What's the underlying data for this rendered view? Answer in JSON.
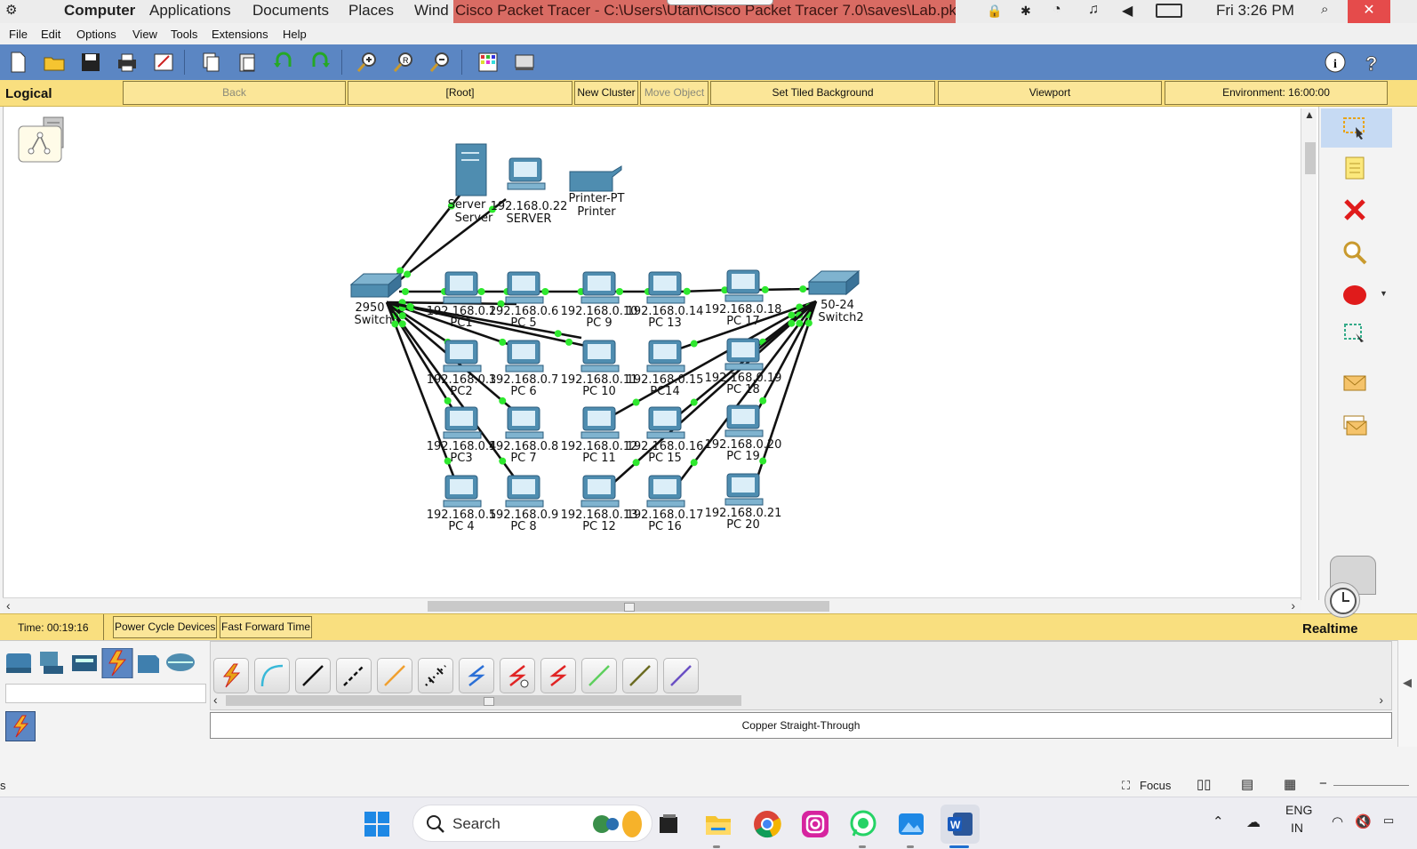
{
  "os_topbar": {
    "menu_items": [
      "Computer",
      "Applications",
      "Documents",
      "Places",
      "Wind"
    ],
    "window_title": "Cisco Packet Tracer - C:\\Users\\Utari\\Cisco Packet Tracer 7.0\\saves\\Lab.pkt",
    "clock": "Fri 3:26 PM",
    "close_glyph": "✕"
  },
  "menubar": {
    "items": [
      "File",
      "Edit",
      "Options",
      "View",
      "Tools",
      "Extensions",
      "Help"
    ]
  },
  "toolbar": {
    "icons": [
      "new-file-icon",
      "open-folder-icon",
      "save-icon",
      "print-icon",
      "activity-wizard-icon",
      "copy-icon",
      "paste-icon",
      "undo-icon",
      "redo-icon",
      "zoom-in-icon",
      "zoom-reset-icon",
      "zoom-out-icon",
      "palette-icon",
      "custom-device-icon",
      "info-icon",
      "help-icon"
    ]
  },
  "logical_bar": {
    "label": "Logical",
    "back": "Back",
    "root": "[Root]",
    "new_cluster": "New Cluster",
    "move_object": "Move Object",
    "set_tiled_background": "Set Tiled Background",
    "viewport": "Viewport",
    "environment": "Environment: 16:00:00"
  },
  "topology": {
    "colors": {
      "link": "#111111",
      "link_light": "#2ee82e",
      "device": "#4f8db0"
    },
    "servers": [
      {
        "label1": "Server",
        "label2": "Server"
      },
      {
        "label1": "192.168.0.22",
        "label2": "SERVER"
      }
    ],
    "printer": {
      "label1": "Printer-PT",
      "label2": "Printer"
    },
    "switches": [
      {
        "label1": "2950",
        "label2": "Switch"
      },
      {
        "label1": "50-24",
        "label2": "Switch2"
      }
    ],
    "pcs": [
      {
        "ip": "192.168.0.2",
        "name": "PC1"
      },
      {
        "ip": "192.168.0.6",
        "name": "PC 5"
      },
      {
        "ip": "192.168.0.10",
        "name": "PC 9"
      },
      {
        "ip": "192.168.0.14",
        "name": "PC 13"
      },
      {
        "ip": "192.168.0.18",
        "name": "PC 17"
      },
      {
        "ip": "192.168.0.3",
        "name": "PC2"
      },
      {
        "ip": "192.168.0.7",
        "name": "PC 6"
      },
      {
        "ip": "192.168.0.11",
        "name": "PC 10"
      },
      {
        "ip": "192.168.0.15",
        "name": "PC14"
      },
      {
        "ip": "192.168.0.19",
        "name": "PC 18"
      },
      {
        "ip": "192.168.0.4",
        "name": "PC3"
      },
      {
        "ip": "192.168.0.8",
        "name": "PC 7"
      },
      {
        "ip": "192.168.0.12",
        "name": "PC 11"
      },
      {
        "ip": "192.168.0.16",
        "name": "PC 15"
      },
      {
        "ip": "192.168.0.20",
        "name": "PC 19"
      },
      {
        "ip": "192.168.0.5",
        "name": "PC 4"
      },
      {
        "ip": "192.168.0.9",
        "name": "PC 8"
      },
      {
        "ip": "192.168.0.13",
        "name": "PC 12"
      },
      {
        "ip": "192.168.0.17",
        "name": "PC 16"
      },
      {
        "ip": "192.168.0.21",
        "name": "PC 20"
      }
    ]
  },
  "right_panel": {
    "tools": [
      "select-icon",
      "note-icon",
      "delete-icon",
      "inspect-icon",
      "draw-ellipse-icon",
      "resize-icon",
      "add-simple-pdu-icon",
      "add-complex-pdu-icon"
    ]
  },
  "status_bar": {
    "time": "Time: 00:19:16",
    "power_cycle": "Power Cycle Devices",
    "fast_forward": "Fast Forward Time",
    "mode": "Realtime"
  },
  "device_panel": {
    "categories": [
      "network-devices-icon",
      "end-devices-icon",
      "components-icon",
      "connections-icon",
      "miscellaneous-icon",
      "multiuser-icon"
    ],
    "cables": [
      {
        "icon": "automatic-cable-icon",
        "color": "#e8a317"
      },
      {
        "icon": "console-cable-icon",
        "color": "#38b8d8"
      },
      {
        "icon": "straight-through-cable-icon",
        "color": "#111111"
      },
      {
        "icon": "crossover-cable-icon",
        "color": "#111111"
      },
      {
        "icon": "fiber-cable-icon",
        "color": "#f0a030"
      },
      {
        "icon": "phone-cable-icon",
        "color": "#111111"
      },
      {
        "icon": "coaxial-cable-icon",
        "color": "#2a6fd6"
      },
      {
        "icon": "serial-dce-cable-icon",
        "color": "#e02424"
      },
      {
        "icon": "serial-dte-cable-icon",
        "color": "#e02424"
      },
      {
        "icon": "octal-cable-icon",
        "color": "#5ed05e"
      },
      {
        "icon": "iot-custom-cable-icon",
        "color": "#6b6b22"
      },
      {
        "icon": "usb-cable-icon",
        "color": "#6a4fc4"
      }
    ],
    "selected_cable": "Copper Straight-Through"
  },
  "word_status": {
    "left": "s",
    "focus": "Focus",
    "zoom_minus": "−"
  },
  "taskbar": {
    "search": "Search",
    "lang1": "ENG",
    "lang2": "IN",
    "apps": [
      "windows-start-icon",
      "search-icon",
      "weather-widget-icon",
      "task-view-icon",
      "file-explorer-icon",
      "chrome-icon",
      "instagram-icon",
      "whatsapp-icon",
      "photos-icon",
      "word-icon"
    ]
  }
}
